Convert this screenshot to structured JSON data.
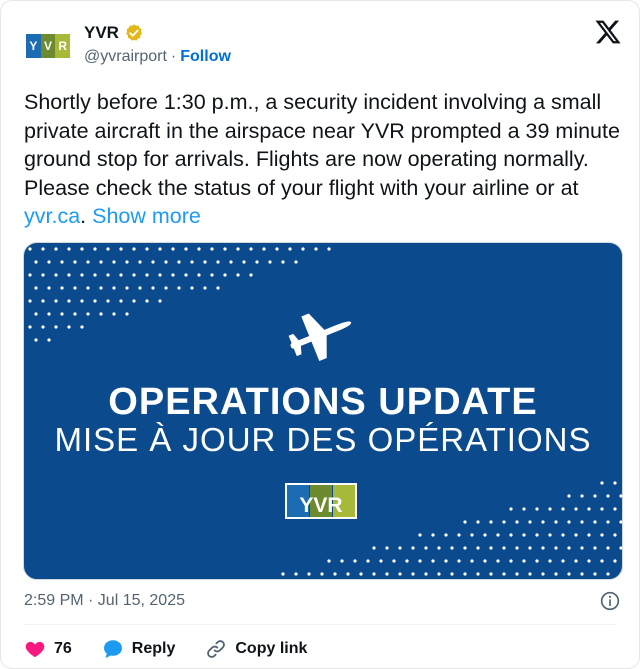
{
  "author": {
    "display_name": "YVR",
    "handle": "@yvrairport",
    "separator": "·",
    "follow_label": "Follow",
    "verified_color": "#e2b719",
    "logo_text": "YVR",
    "logo_colors": [
      "#1b6cb3",
      "#6d8a2e",
      "#a8b93a"
    ]
  },
  "tweet": {
    "text_main": "Shortly before 1:30 p.m., a security incident involving a small private aircraft in the airspace near YVR prompted a 39 minute ground stop for arrivals. Flights are now operating normally. Please check the status of your flight with your airline or at ",
    "link": "yvr.ca",
    "after_link": ".",
    "show_more": "Show more"
  },
  "media": {
    "title": "OPERATIONS UPDATE",
    "subtitle": "MISE À JOUR DES OPÉRATIONS",
    "background_color": "#0b4a8d",
    "icon": "airplane-icon"
  },
  "meta": {
    "timestamp": "2:59 PM · Jul 15, 2025"
  },
  "actions": {
    "likes_count": "76",
    "reply_label": "Reply",
    "copy_link_label": "Copy link",
    "like_color": "#f91880",
    "reply_color": "#1d9bf0"
  }
}
